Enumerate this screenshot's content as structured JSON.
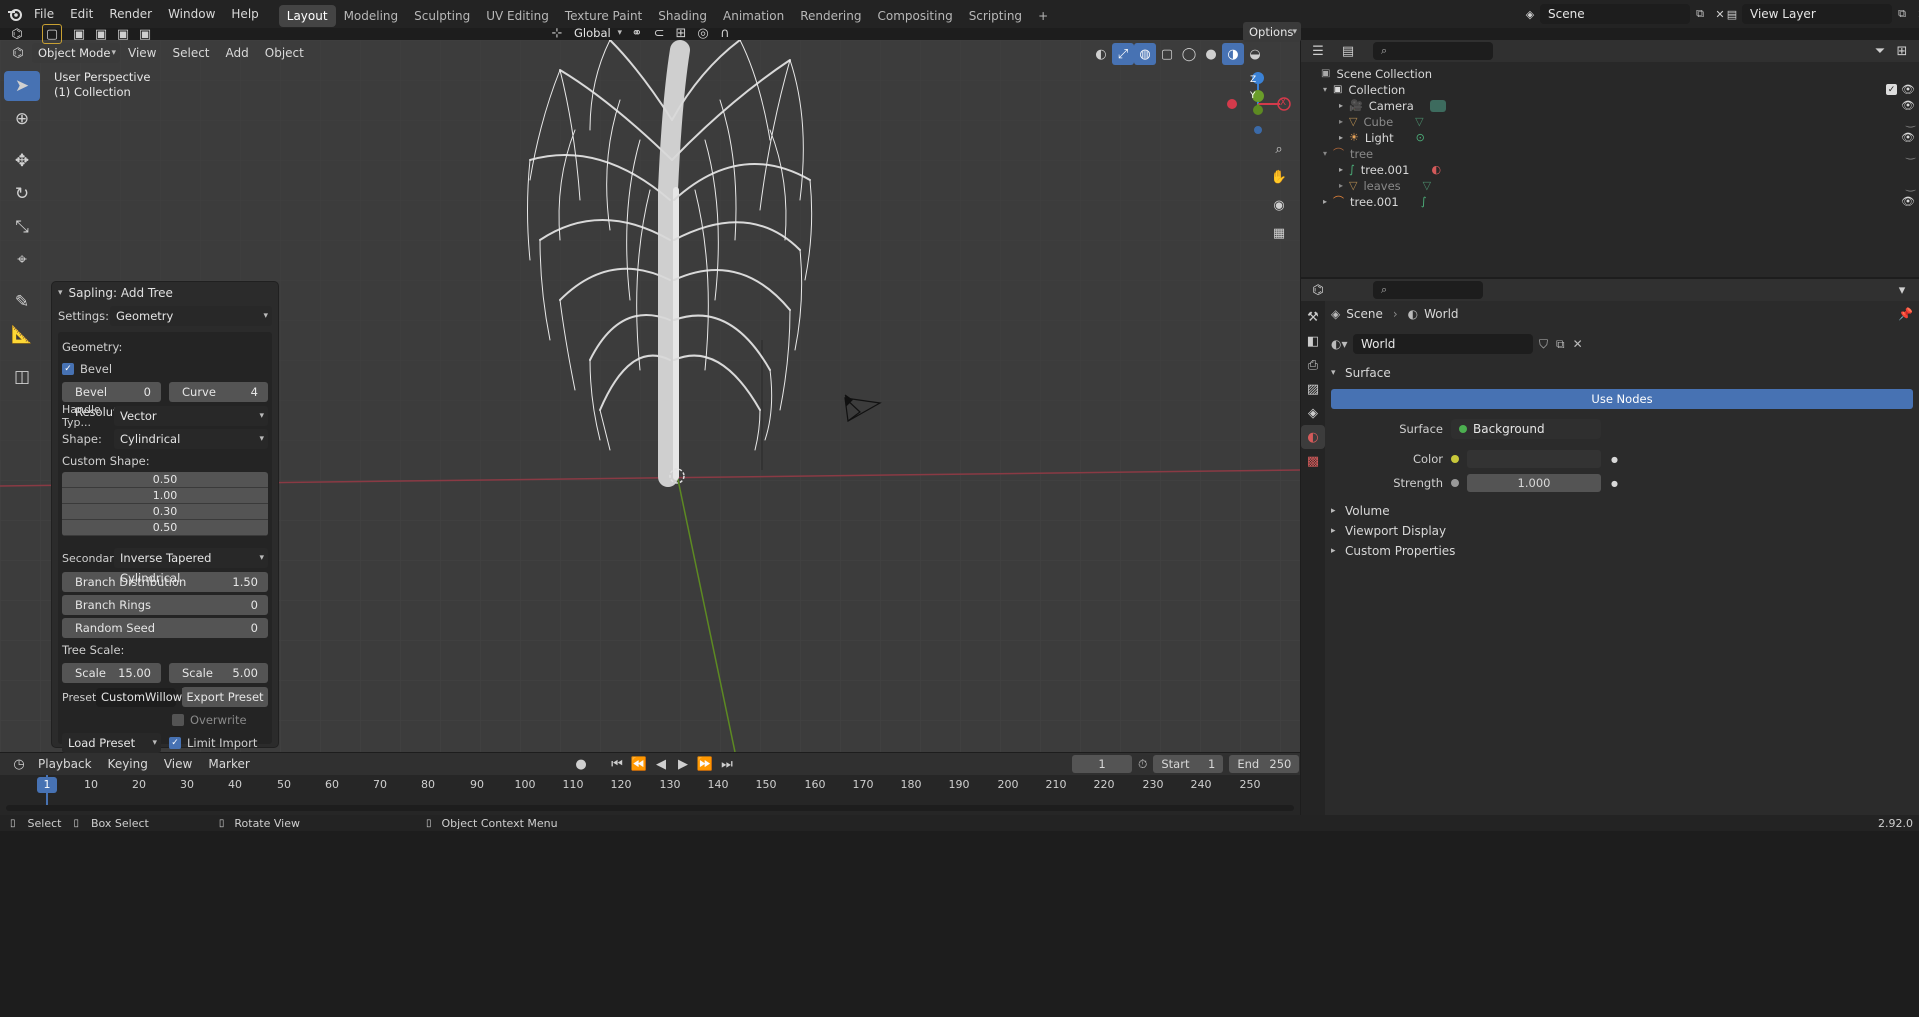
{
  "topbar": {
    "menus": [
      "File",
      "Edit",
      "Render",
      "Window",
      "Help"
    ],
    "workspaces": [
      "Layout",
      "Modeling",
      "Sculpting",
      "UV Editing",
      "Texture Paint",
      "Shading",
      "Animation",
      "Rendering",
      "Compositing",
      "Scripting"
    ],
    "active_workspace": "Layout",
    "scene": "Scene",
    "view_layer": "View Layer"
  },
  "viewport": {
    "mode": "Object Mode",
    "menus": [
      "View",
      "Select",
      "Add",
      "Object"
    ],
    "orientation": "Global",
    "options": "Options",
    "overlay_title": "User Perspective",
    "overlay_subtitle": "(1) Collection",
    "gizmo": {
      "z": "Z",
      "y": "Y",
      "x": "X"
    }
  },
  "op_panel": {
    "title": "Sapling: Add Tree",
    "settings_label": "Settings:",
    "settings_value": "Geometry",
    "geometry_label": "Geometry:",
    "bevel_label": "Bevel",
    "bevel_checked": true,
    "bevel_resolution": {
      "label": "Bevel Resolutio",
      "value": "0"
    },
    "curve_resolution": {
      "label": "Curve Resolutio",
      "value": "4"
    },
    "handle_type": {
      "label": "Handle Typ...",
      "value": "Vector"
    },
    "shape": {
      "label": "Shape:",
      "value": "Cylindrical"
    },
    "custom_shape_label": "Custom Shape:",
    "custom_shape": [
      "0.50",
      "1.00",
      "0.30",
      "0.50"
    ],
    "secondary": {
      "label": "Secondary ...",
      "value": "Inverse Tapered Cylindrical"
    },
    "branch_distribution": {
      "label": "Branch Distribution",
      "value": "1.50"
    },
    "branch_rings": {
      "label": "Branch Rings",
      "value": "0"
    },
    "random_seed": {
      "label": "Random Seed",
      "value": "0"
    },
    "tree_scale_label": "Tree Scale:",
    "scale": {
      "label": "Scale",
      "value": "15.00"
    },
    "scale_variation": {
      "label": "Scale Variat",
      "value": "5.00"
    },
    "preset_label": "Preset...",
    "preset_value": "CustomWillow",
    "export_preset": "Export Preset",
    "overwrite": "Overwrite",
    "load_preset": "Load Preset",
    "limit_import": "Limit Import"
  },
  "outliner": {
    "search_placeholder": "",
    "rows": [
      {
        "label": "Scene Collection",
        "indent": 0,
        "dim": false
      },
      {
        "label": "Collection",
        "indent": 1,
        "dim": false
      },
      {
        "label": "Camera",
        "indent": 2,
        "dim": false
      },
      {
        "label": "Cube",
        "indent": 2,
        "dim": true
      },
      {
        "label": "Light",
        "indent": 2,
        "dim": false
      },
      {
        "label": "tree",
        "indent": 1,
        "dim": true
      },
      {
        "label": "tree.001",
        "indent": 2,
        "dim": false
      },
      {
        "label": "leaves",
        "indent": 2,
        "dim": true
      },
      {
        "label": "tree.001",
        "indent": 1,
        "dim": false
      }
    ]
  },
  "properties": {
    "breadcrumb_scene": "Scene",
    "breadcrumb_world": "World",
    "world_name": "World",
    "surface_panel": "Surface",
    "use_nodes": "Use Nodes",
    "surface_label": "Surface",
    "surface_value": "Background",
    "color_label": "Color",
    "strength_label": "Strength",
    "strength_value": "1.000",
    "panels": [
      "Volume",
      "Viewport Display",
      "Custom Properties"
    ]
  },
  "timeline": {
    "menus": [
      "Playback",
      "Keying",
      "View",
      "Marker"
    ],
    "current_frame": "1",
    "start_label": "Start",
    "start_value": "1",
    "end_label": "End",
    "end_value": "250",
    "ticks": [
      "1",
      "10",
      "20",
      "30",
      "40",
      "50",
      "60",
      "70",
      "80",
      "90",
      "100",
      "110",
      "120",
      "130",
      "140",
      "150",
      "160",
      "170",
      "180",
      "190",
      "200",
      "210",
      "220",
      "230",
      "240",
      "250"
    ]
  },
  "statusbar": {
    "select": "Select",
    "box_select": "Box Select",
    "rotate_view": "Rotate View",
    "context_menu": "Object Context Menu",
    "version": "2.92.0"
  },
  "colors": {
    "accent": "#4772b3",
    "x_axis": "#d43a4b",
    "y_axis": "#6a9d2a",
    "z_axis": "#3b82d6"
  }
}
